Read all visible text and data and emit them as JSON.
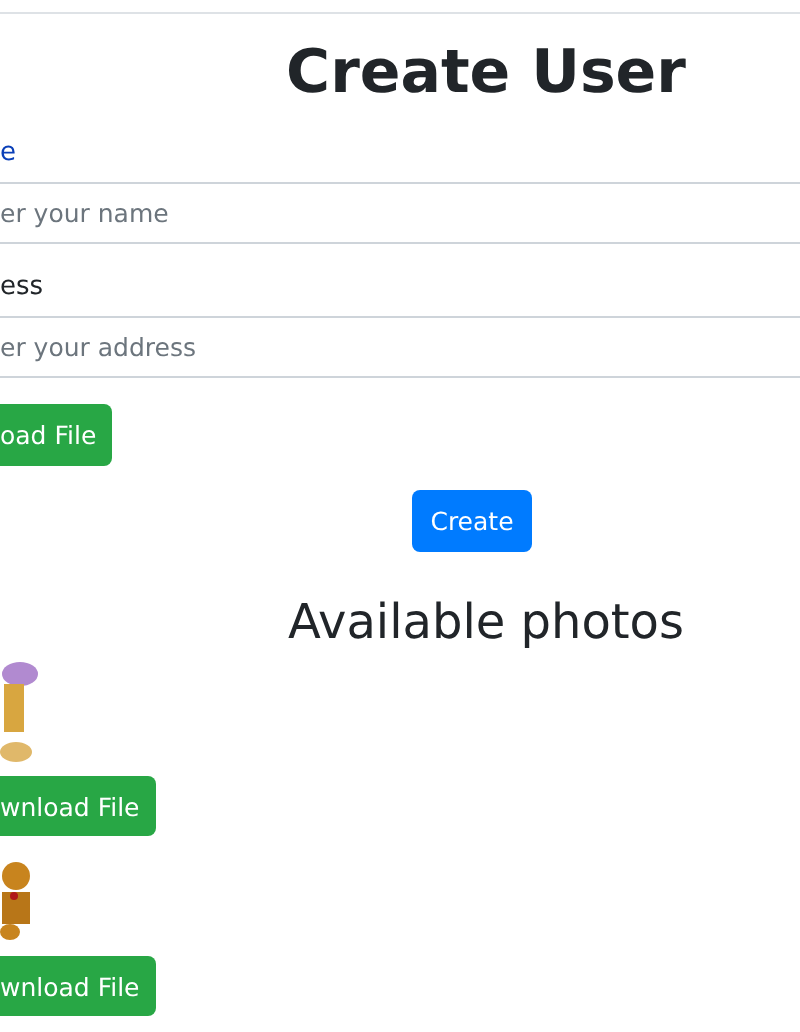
{
  "title": "Create User",
  "fields": [
    {
      "label": "e",
      "placeholder": "er your name"
    },
    {
      "label": "ess",
      "placeholder": "er your address"
    }
  ],
  "upload_button": "oad File",
  "create_button": "Create",
  "photos_heading": "Available photos",
  "photos": [
    {
      "kind": "purple-hair",
      "button": "wnload File"
    },
    {
      "kind": "brown-dog",
      "button": "wnload File"
    }
  ]
}
